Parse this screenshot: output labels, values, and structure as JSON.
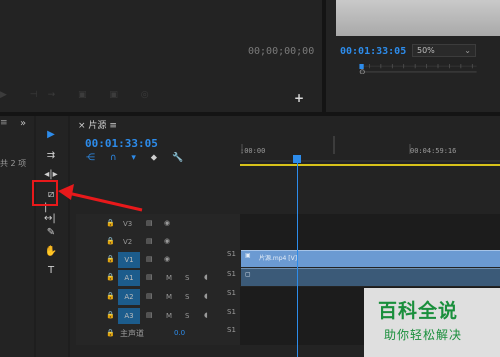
{
  "source_monitor": {
    "timecode": "00;00;00;00"
  },
  "program_monitor": {
    "timecode": "00:01:33:05",
    "zoom": "50%",
    "zoom_chevron": "⌄"
  },
  "transport": {
    "buttons": "▶ ⊣→ ▣ ▣ ◎",
    "add": "+"
  },
  "project": {
    "close": "≡",
    "overflow": "»",
    "item_count": "共 2 项"
  },
  "tools": {
    "items": [
      "▶",
      "⇉",
      "◂|▸",
      "⧄",
      "|↔|",
      "✎",
      "✋",
      "T"
    ]
  },
  "timeline": {
    "title": "片源",
    "menu_icon": "≡",
    "timecode": "00:01:33:05",
    "ruler_start": ":00:00",
    "ruler_mark": "00:04:59:16",
    "header_icons": {
      "snap": "⋲",
      "linked": "∩",
      "marker": "▾",
      "settings": "🔧"
    },
    "video_tracks": [
      {
        "name": "V3",
        "target": ""
      },
      {
        "name": "V2",
        "target": ""
      },
      {
        "name": "V1",
        "target": "V1",
        "target_on": true
      }
    ],
    "audio_tracks": [
      {
        "name": "A1",
        "target": "A1",
        "m": "M",
        "s": "S"
      },
      {
        "name": "A2",
        "target": "A2",
        "m": "M",
        "s": "S"
      },
      {
        "name": "A3",
        "target": "A3",
        "m": "M",
        "s": "S"
      }
    ],
    "master": {
      "label": "主声道",
      "value": "0.0"
    },
    "track_markers": [
      "S1",
      "S1",
      "S1",
      "S1",
      "S1"
    ],
    "video_clip_label": "片源.mp4 [V]",
    "audio_clip_label": ""
  },
  "lock_icon": "🔒",
  "eye_icon": "◉",
  "film_icon": "▤",
  "mic_icon": "◖",
  "colors": {
    "accent": "#2d8ceb",
    "highlight": "#e8191b",
    "work_area": "#d8c21a",
    "video_clip": "#6b9ad2",
    "audio_clip": "#3b5a78"
  },
  "watermark": {
    "title": "百科全说",
    "subtitle": "助你轻松解决"
  }
}
